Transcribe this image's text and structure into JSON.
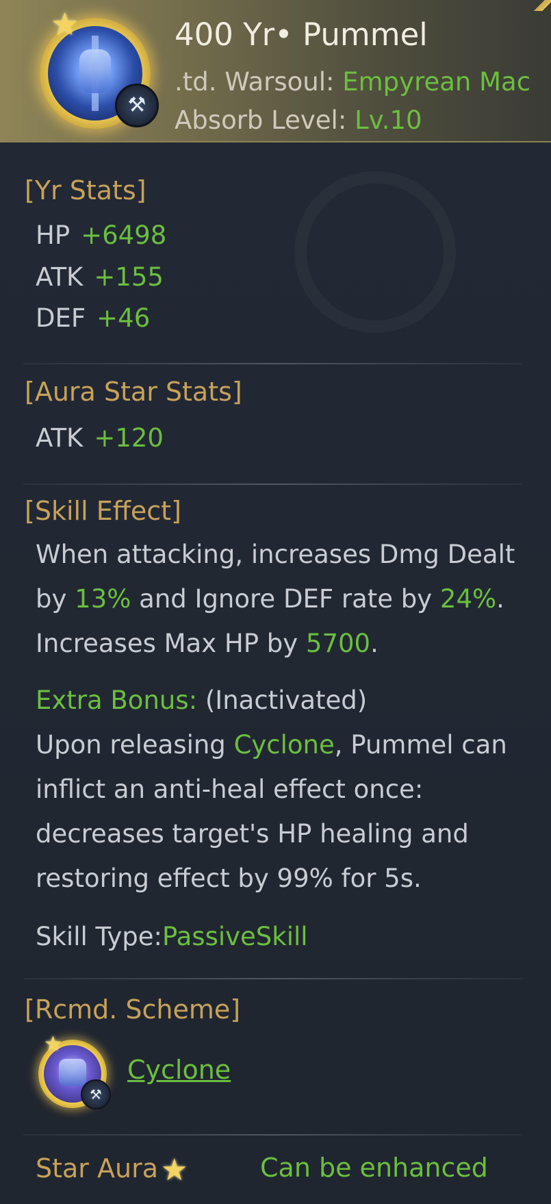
{
  "header": {
    "title": "400 Yr•  Pummel",
    "warsoul_label": ".td. Warsoul: ",
    "warsoul_value": "Empyrean Mac",
    "absorb_label": "Absorb Level: ",
    "absorb_value": "Lv.10",
    "icon": "warsoul-hammer-icon",
    "badge_icon": "axe-class-icon"
  },
  "yr_stats": {
    "title": "[Yr Stats]",
    "items": [
      {
        "label": "HP",
        "value": "+6498"
      },
      {
        "label": "ATK",
        "value": "+155"
      },
      {
        "label": "DEF",
        "value": "+46"
      }
    ]
  },
  "aura_star_stats": {
    "title": "[Aura Star Stats]",
    "items": [
      {
        "label": "ATK",
        "value": "+120"
      }
    ]
  },
  "skill_effect": {
    "title": "[Skill Effect]",
    "line1": "When attacking, increases Dmg Dealt",
    "line2_a": "by ",
    "line2_dmg": "13%",
    "line2_b": " and Ignore DEF rate by ",
    "line2_def": "24%",
    "line2_c": ".",
    "line3_a": "Increases Max HP by ",
    "line3_hp": "5700",
    "line3_b": ".",
    "extra_label": "Extra Bonus: ",
    "extra_status": "(Inactivated)",
    "extra_a": "Upon releasing ",
    "extra_skill": "Cyclone",
    "extra_b": ", Pummel can inflict an anti-heal effect once: decreases target's HP healing and restoring effect by 99% for 5s.",
    "type_label": "Skill Type:",
    "type_value": "PassiveSkill"
  },
  "rcmd_scheme": {
    "title": "[Rcmd. Scheme]",
    "item_name": "Cyclone",
    "item_icon": "cyclone-warsoul-icon"
  },
  "footer": {
    "star_aura_label": "Star Aura",
    "enhance_status": "Can be enhanced"
  },
  "colors": {
    "background": "#222833",
    "accent_green": "#6bbf3f",
    "section_gold": "#c8a25a",
    "header_gold": "#8e8457"
  }
}
